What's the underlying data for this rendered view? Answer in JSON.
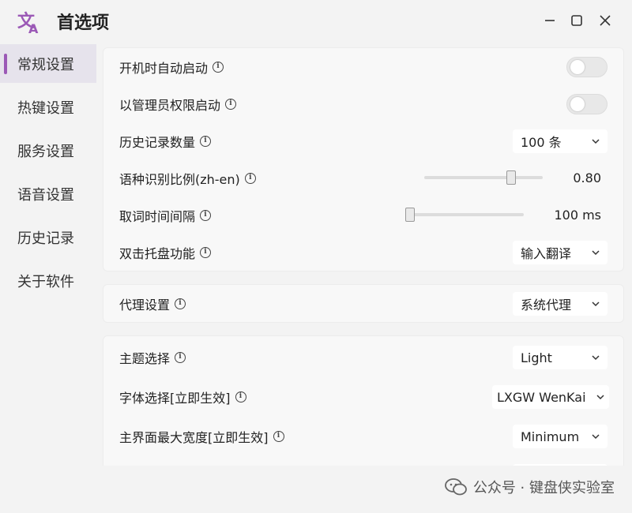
{
  "window": {
    "title": "首选项"
  },
  "sidebar": {
    "items": [
      {
        "label": "常规设置",
        "active": true
      },
      {
        "label": "热键设置"
      },
      {
        "label": "服务设置"
      },
      {
        "label": "语音设置"
      },
      {
        "label": "历史记录"
      },
      {
        "label": "关于软件"
      }
    ]
  },
  "general": {
    "autostart_label": "开机时自动启动",
    "autostart_on": false,
    "admin_label": "以管理员权限启动",
    "admin_on": false,
    "history_count_label": "历史记录数量",
    "history_count_value": "100 条",
    "lang_ratio_label": "语种识别比例(zh-en)",
    "lang_ratio_value": "0.80",
    "lang_ratio_fraction": 0.8,
    "interval_label": "取词时间间隔",
    "interval_value": "100 ms",
    "interval_fraction": 0.0,
    "tray_dblclick_label": "双击托盘功能",
    "tray_dblclick_value": "输入翻译"
  },
  "proxy": {
    "label": "代理设置",
    "value": "系统代理"
  },
  "appearance": {
    "theme_label": "主题选择",
    "theme_value": "Light",
    "font_label": "字体选择[立即生效]",
    "font_value": "LXGW WenKai",
    "width_label": "主界面最大宽度[立即生效]",
    "width_value": "Minimum"
  },
  "watermark": {
    "text": "公众号 · 键盘侠实验室"
  },
  "colors": {
    "accent": "#9b59b6",
    "background": "#f3f3f3",
    "card": "#f8f8f8"
  }
}
